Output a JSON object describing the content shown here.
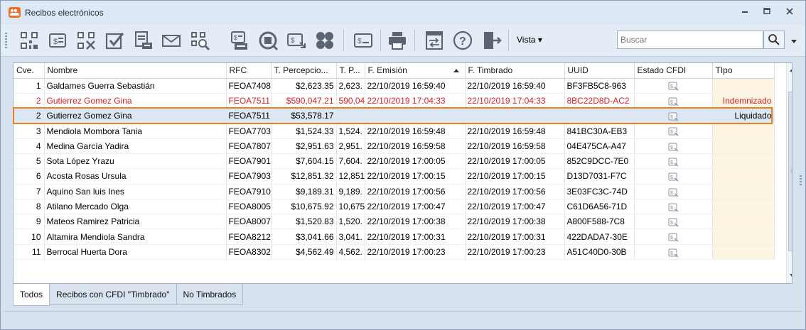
{
  "window": {
    "title": "Recibos electrónicos",
    "controls": [
      "minimize-icon",
      "restore-icon",
      "close-icon"
    ]
  },
  "toolbar": {
    "icons": [
      "qr-code-icon",
      "receipt-icon",
      "qr-code-x-icon",
      "checkbox-icon",
      "print-document-icon",
      "envelope-icon",
      "qr-search-icon",
      "receipt-print-icon",
      "magnify-receipt-icon",
      "receipt-export-icon",
      "modules-icon",
      "console-icon",
      "printer-icon",
      "transfer-window-icon",
      "help-icon",
      "exit-door-icon"
    ],
    "vista_label": "Vista",
    "search_placeholder": "Buscar"
  },
  "grid": {
    "columns": [
      "Cve.",
      "Nombre",
      "RFC",
      "T. Percepcio...",
      "T. P...",
      "F. Emisión",
      "F. Timbrado",
      "UUID",
      "Estado CFDI",
      "TIpo"
    ],
    "sorted_column": "F. Emisión",
    "sort_direction": "ascending",
    "rows": [
      {
        "cve": "1",
        "nombre": "Galdames Guerra Sebastián",
        "rfc": "FEOA7408",
        "tper": "$2,623.35",
        "tp": "2,623.",
        "femision": "22/10/2019 16:59:40",
        "ftimbrado": "22/10/2019 16:59:40",
        "uuid": "BF3FB5C8-963",
        "tipo": "",
        "style": "normal",
        "cfdi_icon": true
      },
      {
        "cve": "2",
        "nombre": "Gutierrez Gomez Gina",
        "rfc": "FEOA7511",
        "tper": "$590,047.21",
        "tp": "590,04",
        "femision": "22/10/2019 17:04:33",
        "ftimbrado": "22/10/2019 17:04:33",
        "uuid": "8BC22D8D-AC2",
        "tipo": "Indemnizado",
        "style": "red",
        "cfdi_icon": true
      },
      {
        "cve": "2",
        "nombre": "Gutierrez Gomez Gina",
        "rfc": "FEOA7511",
        "tper": "$53,578.17",
        "tp": "",
        "femision": "",
        "ftimbrado": "",
        "uuid": "",
        "tipo": "Liquidado",
        "style": "selected",
        "cfdi_icon": true
      },
      {
        "cve": "3",
        "nombre": "Mendiola Mombora Tania",
        "rfc": "FEOA7703",
        "tper": "$1,524.33",
        "tp": "1,524.",
        "femision": "22/10/2019 16:59:48",
        "ftimbrado": "22/10/2019 16:59:48",
        "uuid": "841BC30A-EB3",
        "tipo": "",
        "style": "normal",
        "cfdi_icon": true
      },
      {
        "cve": "4",
        "nombre": "Medina García Yadira",
        "rfc": "FEOA7807",
        "tper": "$2,951.63",
        "tp": "2,951.",
        "femision": "22/10/2019 16:59:58",
        "ftimbrado": "22/10/2019 16:59:58",
        "uuid": "04E475CA-A47",
        "tipo": "",
        "style": "normal",
        "cfdi_icon": true
      },
      {
        "cve": "5",
        "nombre": "Sota López Yrazu",
        "rfc": "FEOA7901",
        "tper": "$7,604.15",
        "tp": "7,604.",
        "femision": "22/10/2019 17:00:05",
        "ftimbrado": "22/10/2019 17:00:05",
        "uuid": "852C9DCC-7E0",
        "tipo": "",
        "style": "normal",
        "cfdi_icon": true
      },
      {
        "cve": "6",
        "nombre": "Acosta Rosas Ursula",
        "rfc": "FEOA7903",
        "tper": "$12,851.32",
        "tp": "12,851",
        "femision": "22/10/2019 17:00:15",
        "ftimbrado": "22/10/2019 17:00:15",
        "uuid": "D13D7031-F7C",
        "tipo": "",
        "style": "normal",
        "cfdi_icon": true
      },
      {
        "cve": "7",
        "nombre": "Aquino San luis Ines",
        "rfc": "FEOA7910",
        "tper": "$9,189.31",
        "tp": "9,189.",
        "femision": "22/10/2019 17:00:56",
        "ftimbrado": "22/10/2019 17:00:56",
        "uuid": "3E03FC3C-74D",
        "tipo": "",
        "style": "normal",
        "cfdi_icon": true
      },
      {
        "cve": "8",
        "nombre": "Atilano Mercado Olga",
        "rfc": "FEOA8005",
        "tper": "$10,675.92",
        "tp": "10,675",
        "femision": "22/10/2019 17:00:47",
        "ftimbrado": "22/10/2019 17:00:47",
        "uuid": "C61D6A56-71D",
        "tipo": "",
        "style": "normal",
        "cfdi_icon": true
      },
      {
        "cve": "9",
        "nombre": "Mateos Ramirez Patricia",
        "rfc": "FEOA8007",
        "tper": "$1,520.83",
        "tp": "1,520.",
        "femision": "22/10/2019 17:00:38",
        "ftimbrado": "22/10/2019 17:00:38",
        "uuid": "A800F588-7C8",
        "tipo": "",
        "style": "normal",
        "cfdi_icon": true
      },
      {
        "cve": "10",
        "nombre": "Altamira Mendiola Sandra",
        "rfc": "FEOA8212",
        "tper": "$3,041.66",
        "tp": "3,041.",
        "femision": "22/10/2019 17:00:31",
        "ftimbrado": "22/10/2019 17:00:31",
        "uuid": "422DADA7-30E",
        "tipo": "",
        "style": "normal",
        "cfdi_icon": true
      },
      {
        "cve": "11",
        "nombre": "Berrocal Huerta Dora",
        "rfc": "FEOA8302",
        "tper": "$4,562.49",
        "tp": "4,562.",
        "femision": "22/10/2019 17:00:23",
        "ftimbrado": "22/10/2019 17:00:23",
        "uuid": "A51C40D0-30B",
        "tipo": "",
        "style": "normal",
        "cfdi_icon": true
      }
    ]
  },
  "tabs": [
    {
      "label": "Todos",
      "active": true
    },
    {
      "label": "Recibos con CFDI \"Timbrado\"",
      "active": false
    },
    {
      "label": "No Timbrados",
      "active": false
    }
  ],
  "colors": {
    "accent_red": "#d3232a",
    "selection_outline": "#e8821c",
    "tipo_column_bg": "#fdf5e2"
  }
}
